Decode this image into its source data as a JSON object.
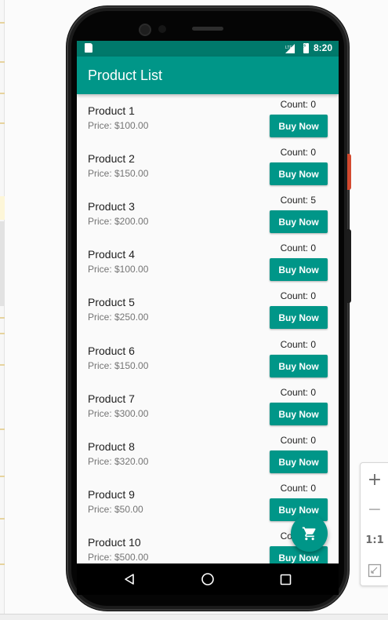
{
  "status_bar": {
    "time": "8:20",
    "icons": [
      "sd-card-icon",
      "signal-icon",
      "battery-charging-icon"
    ]
  },
  "app_bar": {
    "title": "Product List"
  },
  "products": [
    {
      "name": "Product 1",
      "price": "Price: $100.00",
      "count": "Count: 0",
      "button": "Buy Now"
    },
    {
      "name": "Product 2",
      "price": "Price: $150.00",
      "count": "Count: 0",
      "button": "Buy Now"
    },
    {
      "name": "Product 3",
      "price": "Price: $200.00",
      "count": "Count: 5",
      "button": "Buy Now"
    },
    {
      "name": "Product 4",
      "price": "Price: $100.00",
      "count": "Count: 0",
      "button": "Buy Now"
    },
    {
      "name": "Product 5",
      "price": "Price: $250.00",
      "count": "Count: 0",
      "button": "Buy Now"
    },
    {
      "name": "Product 6",
      "price": "Price: $150.00",
      "count": "Count: 0",
      "button": "Buy Now"
    },
    {
      "name": "Product 7",
      "price": "Price: $300.00",
      "count": "Count: 0",
      "button": "Buy Now"
    },
    {
      "name": "Product 8",
      "price": "Price: $320.00",
      "count": "Count: 0",
      "button": "Buy Now"
    },
    {
      "name": "Product 9",
      "price": "Price: $50.00",
      "count": "Count: 0",
      "button": "Buy Now"
    },
    {
      "name": "Product 10",
      "price": "Price: $500.00",
      "count": "Count: 0",
      "button": "Buy Now"
    }
  ],
  "fab": {
    "icon": "shopping-cart-icon"
  },
  "nav_bar": {
    "icons": [
      "back-icon",
      "home-icon",
      "recents-icon"
    ]
  },
  "zoom_controls": {
    "zoom_in": "+",
    "zoom_out": "−",
    "actual_size": "1:1",
    "fit_icon": "fit-screen-icon"
  },
  "colors": {
    "primary": "#009688",
    "primary_dark": "#00796b",
    "text_primary": "#212121",
    "text_secondary": "#757575",
    "background": "#fafafa"
  }
}
